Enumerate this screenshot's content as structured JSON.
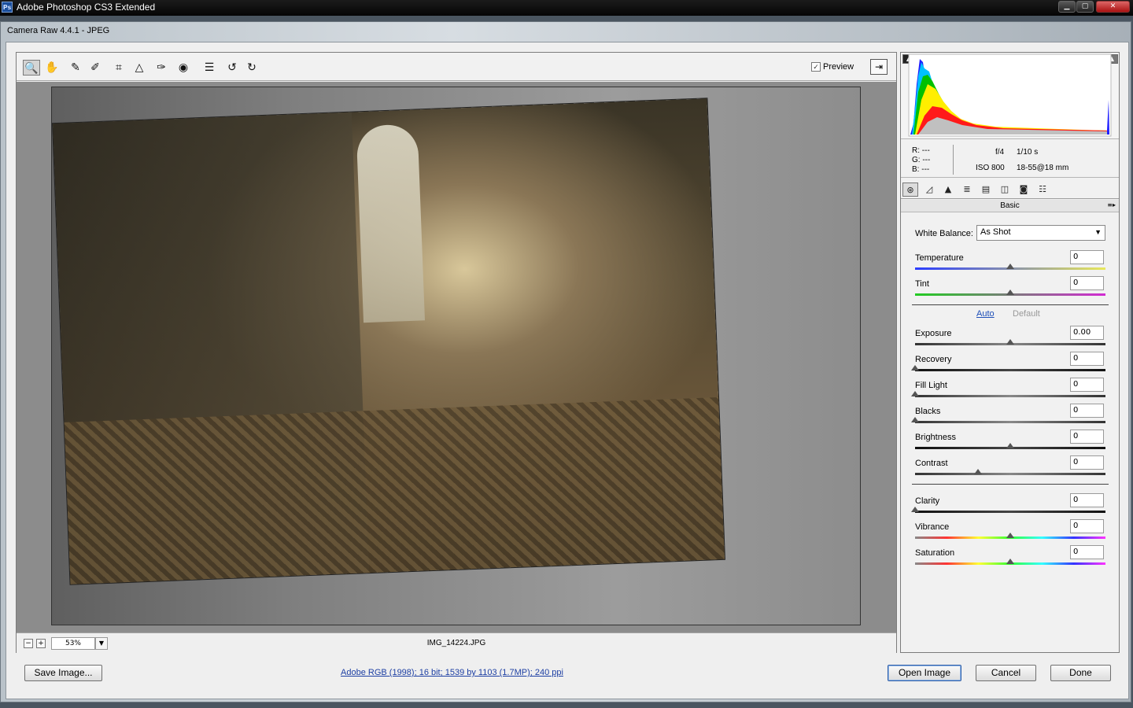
{
  "os_window": {
    "title": "Adobe Photoshop CS3 Extended",
    "logo": "Ps",
    "buttons": {
      "minimize": "▁",
      "maximize": "▢",
      "close": "✕"
    }
  },
  "dialog": {
    "title": "Camera Raw 4.4.1  -  JPEG"
  },
  "toolbar": {
    "tools": [
      {
        "name": "zoom-tool",
        "icon": "magnifier-icon",
        "glyph": "🔍",
        "active": true
      },
      {
        "name": "hand-tool",
        "icon": "hand-icon",
        "glyph": "✋",
        "active": false
      },
      {
        "name": "white-balance-tool",
        "icon": "eyedropper-icon",
        "glyph": "✎",
        "active": false
      },
      {
        "name": "color-sampler-tool",
        "icon": "sampler-icon",
        "glyph": "✐",
        "active": false
      },
      {
        "name": "crop-tool",
        "icon": "crop-icon",
        "glyph": "⌗",
        "active": false
      },
      {
        "name": "straighten-tool",
        "icon": "straighten-icon",
        "glyph": "△",
        "active": false
      },
      {
        "name": "retouch-tool",
        "icon": "brush-icon",
        "glyph": "✑",
        "active": false
      },
      {
        "name": "red-eye-tool",
        "icon": "eye-icon",
        "glyph": "◉",
        "active": false
      },
      {
        "name": "preferences-tool",
        "icon": "list-icon",
        "glyph": "☰",
        "active": false
      },
      {
        "name": "rotate-left-tool",
        "icon": "rotate-ccw-icon",
        "glyph": "↺",
        "active": false
      },
      {
        "name": "rotate-right-tool",
        "icon": "rotate-cw-icon",
        "glyph": "↻",
        "active": false
      }
    ],
    "preview_label": "Preview",
    "preview_checked": "✓",
    "fullscreen_glyph": "⇥"
  },
  "status": {
    "zoom_out": "−",
    "zoom_in": "+",
    "zoom_value": "53%",
    "zoom_drop": "▼",
    "filename": "IMG_14224.JPG"
  },
  "histogram": {
    "shadow_clip": "▲",
    "highlight_clip": "▲"
  },
  "info": {
    "r_label": "R:",
    "r_value": "---",
    "g_label": "G:",
    "g_value": "---",
    "b_label": "B:",
    "b_value": "---",
    "aperture": "f/4",
    "shutter": "1/10 s",
    "iso": "ISO 800",
    "lens": "18-55@18 mm"
  },
  "tabs": [
    {
      "name": "basic",
      "glyph": "⊛",
      "active": true
    },
    {
      "name": "tone-curve",
      "glyph": "◿",
      "active": false
    },
    {
      "name": "detail",
      "glyph": "▲",
      "active": false
    },
    {
      "name": "hsl",
      "glyph": "≣",
      "active": false
    },
    {
      "name": "split-toning",
      "glyph": "▤",
      "active": false
    },
    {
      "name": "lens-corrections",
      "glyph": "◫",
      "active": false
    },
    {
      "name": "camera-calibration",
      "glyph": "◙",
      "active": false
    },
    {
      "name": "presets",
      "glyph": "☷",
      "active": false
    }
  ],
  "panel": {
    "title": "Basic",
    "menu_glyph": "≡▸",
    "white_balance_label": "White Balance:",
    "white_balance_value": "As Shot",
    "white_balance_arrow": "▼",
    "auto_label": "Auto",
    "default_label": "Default"
  },
  "sliders": [
    {
      "name": "temperature",
      "label": "Temperature",
      "value": "0",
      "position": 0.5,
      "track": "temperature"
    },
    {
      "name": "tint",
      "label": "Tint",
      "value": "0",
      "position": 0.5,
      "track": "tint"
    },
    {
      "name": "exposure",
      "label": "Exposure",
      "value": "0.00",
      "position": 0.5,
      "track": "gray"
    },
    {
      "name": "recovery",
      "label": "Recovery",
      "value": "0",
      "position": 0.0,
      "track": "dark"
    },
    {
      "name": "fill-light",
      "label": "Fill Light",
      "value": "0",
      "position": 0.0,
      "track": "gray"
    },
    {
      "name": "blacks",
      "label": "Blacks",
      "value": "0",
      "position": 0.0,
      "track": "gray"
    },
    {
      "name": "brightness",
      "label": "Brightness",
      "value": "0",
      "position": 0.5,
      "track": "dark"
    },
    {
      "name": "contrast",
      "label": "Contrast",
      "value": "0",
      "position": 0.33,
      "track": "gray"
    },
    {
      "name": "clarity",
      "label": "Clarity",
      "value": "0",
      "position": 0.0,
      "track": "dark"
    },
    {
      "name": "vibrance",
      "label": "Vibrance",
      "value": "0",
      "position": 0.5,
      "track": "spectrum"
    },
    {
      "name": "saturation",
      "label": "Saturation",
      "value": "0",
      "position": 0.5,
      "track": "spectrum"
    }
  ],
  "bottom": {
    "save_image": "Save Image...",
    "image_info": "Adobe RGB (1998); 16 bit; 1539 by 1103 (1.7MP); 240 ppi",
    "open_image": "Open Image",
    "cancel": "Cancel",
    "done": "Done"
  }
}
